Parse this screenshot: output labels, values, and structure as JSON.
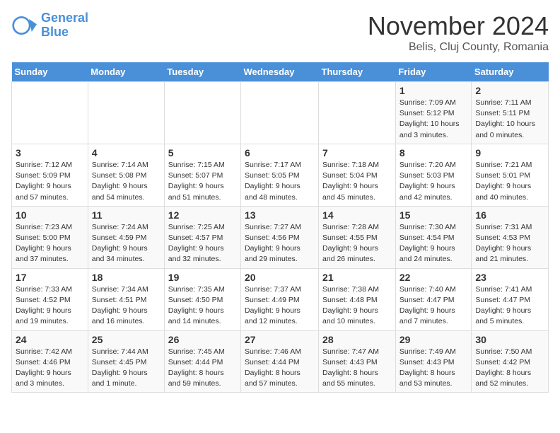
{
  "logo": {
    "line1": "General",
    "line2": "Blue"
  },
  "title": "November 2024",
  "location": "Belis, Cluj County, Romania",
  "days_of_week": [
    "Sunday",
    "Monday",
    "Tuesday",
    "Wednesday",
    "Thursday",
    "Friday",
    "Saturday"
  ],
  "weeks": [
    [
      {
        "day": "",
        "info": ""
      },
      {
        "day": "",
        "info": ""
      },
      {
        "day": "",
        "info": ""
      },
      {
        "day": "",
        "info": ""
      },
      {
        "day": "",
        "info": ""
      },
      {
        "day": "1",
        "info": "Sunrise: 7:09 AM\nSunset: 5:12 PM\nDaylight: 10 hours and 3 minutes."
      },
      {
        "day": "2",
        "info": "Sunrise: 7:11 AM\nSunset: 5:11 PM\nDaylight: 10 hours and 0 minutes."
      }
    ],
    [
      {
        "day": "3",
        "info": "Sunrise: 7:12 AM\nSunset: 5:09 PM\nDaylight: 9 hours and 57 minutes."
      },
      {
        "day": "4",
        "info": "Sunrise: 7:14 AM\nSunset: 5:08 PM\nDaylight: 9 hours and 54 minutes."
      },
      {
        "day": "5",
        "info": "Sunrise: 7:15 AM\nSunset: 5:07 PM\nDaylight: 9 hours and 51 minutes."
      },
      {
        "day": "6",
        "info": "Sunrise: 7:17 AM\nSunset: 5:05 PM\nDaylight: 9 hours and 48 minutes."
      },
      {
        "day": "7",
        "info": "Sunrise: 7:18 AM\nSunset: 5:04 PM\nDaylight: 9 hours and 45 minutes."
      },
      {
        "day": "8",
        "info": "Sunrise: 7:20 AM\nSunset: 5:03 PM\nDaylight: 9 hours and 42 minutes."
      },
      {
        "day": "9",
        "info": "Sunrise: 7:21 AM\nSunset: 5:01 PM\nDaylight: 9 hours and 40 minutes."
      }
    ],
    [
      {
        "day": "10",
        "info": "Sunrise: 7:23 AM\nSunset: 5:00 PM\nDaylight: 9 hours and 37 minutes."
      },
      {
        "day": "11",
        "info": "Sunrise: 7:24 AM\nSunset: 4:59 PM\nDaylight: 9 hours and 34 minutes."
      },
      {
        "day": "12",
        "info": "Sunrise: 7:25 AM\nSunset: 4:57 PM\nDaylight: 9 hours and 32 minutes."
      },
      {
        "day": "13",
        "info": "Sunrise: 7:27 AM\nSunset: 4:56 PM\nDaylight: 9 hours and 29 minutes."
      },
      {
        "day": "14",
        "info": "Sunrise: 7:28 AM\nSunset: 4:55 PM\nDaylight: 9 hours and 26 minutes."
      },
      {
        "day": "15",
        "info": "Sunrise: 7:30 AM\nSunset: 4:54 PM\nDaylight: 9 hours and 24 minutes."
      },
      {
        "day": "16",
        "info": "Sunrise: 7:31 AM\nSunset: 4:53 PM\nDaylight: 9 hours and 21 minutes."
      }
    ],
    [
      {
        "day": "17",
        "info": "Sunrise: 7:33 AM\nSunset: 4:52 PM\nDaylight: 9 hours and 19 minutes."
      },
      {
        "day": "18",
        "info": "Sunrise: 7:34 AM\nSunset: 4:51 PM\nDaylight: 9 hours and 16 minutes."
      },
      {
        "day": "19",
        "info": "Sunrise: 7:35 AM\nSunset: 4:50 PM\nDaylight: 9 hours and 14 minutes."
      },
      {
        "day": "20",
        "info": "Sunrise: 7:37 AM\nSunset: 4:49 PM\nDaylight: 9 hours and 12 minutes."
      },
      {
        "day": "21",
        "info": "Sunrise: 7:38 AM\nSunset: 4:48 PM\nDaylight: 9 hours and 10 minutes."
      },
      {
        "day": "22",
        "info": "Sunrise: 7:40 AM\nSunset: 4:47 PM\nDaylight: 9 hours and 7 minutes."
      },
      {
        "day": "23",
        "info": "Sunrise: 7:41 AM\nSunset: 4:47 PM\nDaylight: 9 hours and 5 minutes."
      }
    ],
    [
      {
        "day": "24",
        "info": "Sunrise: 7:42 AM\nSunset: 4:46 PM\nDaylight: 9 hours and 3 minutes."
      },
      {
        "day": "25",
        "info": "Sunrise: 7:44 AM\nSunset: 4:45 PM\nDaylight: 9 hours and 1 minute."
      },
      {
        "day": "26",
        "info": "Sunrise: 7:45 AM\nSunset: 4:44 PM\nDaylight: 8 hours and 59 minutes."
      },
      {
        "day": "27",
        "info": "Sunrise: 7:46 AM\nSunset: 4:44 PM\nDaylight: 8 hours and 57 minutes."
      },
      {
        "day": "28",
        "info": "Sunrise: 7:47 AM\nSunset: 4:43 PM\nDaylight: 8 hours and 55 minutes."
      },
      {
        "day": "29",
        "info": "Sunrise: 7:49 AM\nSunset: 4:43 PM\nDaylight: 8 hours and 53 minutes."
      },
      {
        "day": "30",
        "info": "Sunrise: 7:50 AM\nSunset: 4:42 PM\nDaylight: 8 hours and 52 minutes."
      }
    ]
  ]
}
